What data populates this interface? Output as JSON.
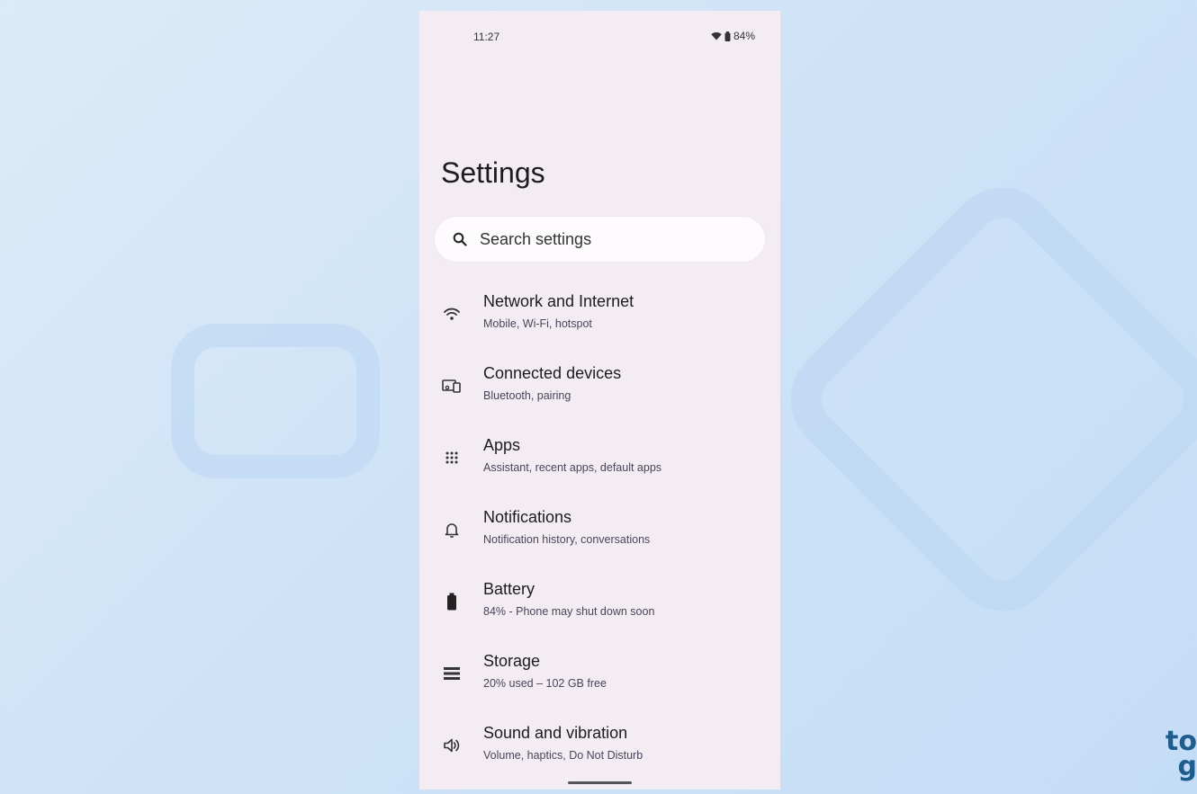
{
  "status_bar": {
    "time": "11:27",
    "battery_percent": "84%",
    "icons": [
      "wifi-icon",
      "battery-icon"
    ]
  },
  "settings": {
    "title": "Settings",
    "search_placeholder": "Search settings",
    "items": [
      {
        "title": "Network and Internet",
        "subtitle": "Mobile, Wi-Fi, hotspot",
        "icon": "wifi-icon"
      },
      {
        "title": "Connected devices",
        "subtitle": "Bluetooth, pairing",
        "icon": "connected-devices-icon"
      },
      {
        "title": "Apps",
        "subtitle": "Assistant, recent apps, default apps",
        "icon": "apps-grid-icon"
      },
      {
        "title": "Notifications",
        "subtitle": "Notification history, conversations",
        "icon": "bell-icon"
      },
      {
        "title": "Battery",
        "subtitle": "84% - Phone may shut down soon",
        "icon": "battery-icon"
      },
      {
        "title": "Storage",
        "subtitle": "20% used – 102 GB free",
        "icon": "storage-icon"
      },
      {
        "title": "Sound and vibration",
        "subtitle": "Volume, haptics, Do Not Disturb",
        "icon": "speaker-icon"
      }
    ]
  },
  "corner_brand": {
    "text": "to\ng"
  },
  "colors": {
    "background": "#cfe3f7",
    "phone_surface": "#f3edf3",
    "search_surface": "#fdfbfd",
    "text_primary": "#1c1b1f",
    "text_secondary": "#4a4458",
    "brand": "#1f5d8f"
  }
}
